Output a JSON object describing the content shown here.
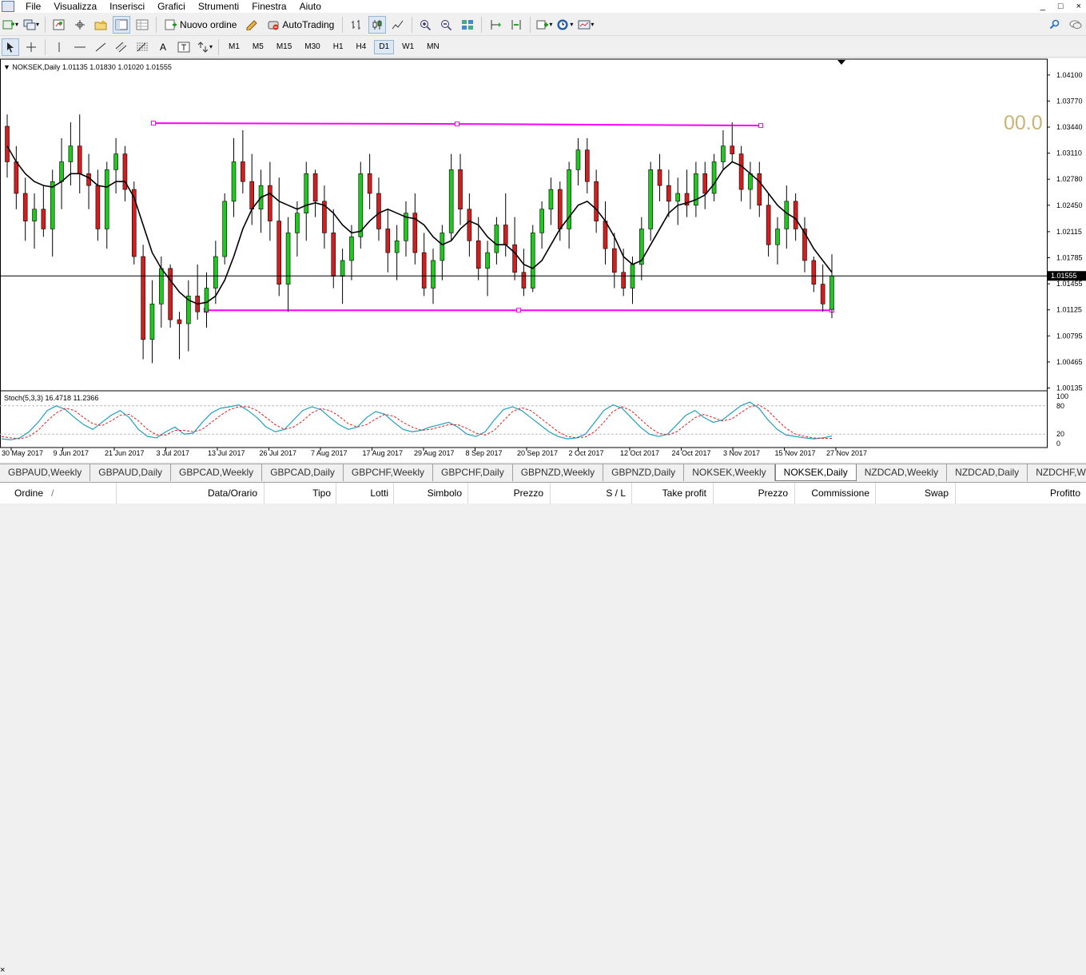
{
  "menu": {
    "items": [
      "File",
      "Visualizza",
      "Inserisci",
      "Grafici",
      "Strumenti",
      "Finestra",
      "Aiuto"
    ],
    "window_controls": [
      "_",
      "□",
      "×"
    ]
  },
  "toolbar": {
    "new_order_label": "Nuovo ordine",
    "autotrading_label": "AutoTrading",
    "timeframes": [
      "M1",
      "M5",
      "M15",
      "M30",
      "H1",
      "H4",
      "D1",
      "W1",
      "MN"
    ],
    "active_timeframe": "D1",
    "text_tool": "A"
  },
  "chart": {
    "symbol_header": "NOKSEK,Daily  1.01135 1.01830 1.01020 1.01555",
    "big_number": "00.0",
    "current_price": "1.01555",
    "indicator_label": "Stoch(5,3,3) 16.4718 11.2366",
    "colors": {
      "bull": "#1ec81e",
      "bear": "#d21e1e",
      "line": "#ff00ff",
      "stoch_main": "#20a0c0",
      "stoch_signal": "#e02020",
      "bignum": "#c8b474"
    }
  },
  "chart_data": {
    "type": "candlestick",
    "price_axis_labels": [
      "1.04100",
      "1.03770",
      "1.03440",
      "1.03110",
      "1.02780",
      "1.02450",
      "1.02115",
      "1.01785",
      "1.01455",
      "1.01125",
      "1.00795",
      "1.00465",
      "1.00135"
    ],
    "ylim": [
      1.0013,
      1.0425
    ],
    "date_labels": [
      "30 May 2017",
      "9 Jun 2017",
      "21 Jun 2017",
      "3 Jul 2017",
      "13 Jul 2017",
      "26 Jul 2017",
      "7 Aug 2017",
      "17 Aug 2017",
      "29 Aug 2017",
      "8 Sep 2017",
      "20 Sep 2017",
      "2 Oct 2017",
      "12 Oct 2017",
      "24 Oct 2017",
      "3 Nov 2017",
      "15 Nov 2017",
      "27 Nov 2017"
    ],
    "levels": [
      {
        "name": "resistance",
        "price": 1.035
      },
      {
        "name": "support",
        "price": 1.0112
      }
    ],
    "candles": [
      [
        1.0345,
        1.036,
        1.028,
        1.03
      ],
      [
        1.03,
        1.032,
        1.024,
        1.026
      ],
      [
        1.026,
        1.028,
        1.02,
        1.0225
      ],
      [
        1.0225,
        1.026,
        1.019,
        1.024
      ],
      [
        1.024,
        1.027,
        1.0205,
        1.0215
      ],
      [
        1.0215,
        1.029,
        1.018,
        1.0275
      ],
      [
        1.0275,
        1.033,
        1.024,
        1.03
      ],
      [
        1.03,
        1.035,
        1.027,
        1.032
      ],
      [
        1.032,
        1.036,
        1.026,
        1.0285
      ],
      [
        1.0285,
        1.031,
        1.024,
        1.027
      ],
      [
        1.027,
        1.029,
        1.02,
        1.0215
      ],
      [
        1.0215,
        1.03,
        1.019,
        1.029
      ],
      [
        1.029,
        1.033,
        1.026,
        1.031
      ],
      [
        1.031,
        1.032,
        1.025,
        1.0265
      ],
      [
        1.0265,
        1.0275,
        1.017,
        1.018
      ],
      [
        1.018,
        1.0195,
        1.005,
        1.0075
      ],
      [
        1.0075,
        1.015,
        1.0045,
        1.012
      ],
      [
        1.012,
        1.018,
        1.009,
        1.0165
      ],
      [
        1.0165,
        1.017,
        1.009,
        1.01
      ],
      [
        1.01,
        1.011,
        1.005,
        1.0095
      ],
      [
        1.0095,
        1.015,
        1.006,
        1.013
      ],
      [
        1.013,
        1.017,
        1.01,
        1.011
      ],
      [
        1.011,
        1.016,
        1.009,
        1.014
      ],
      [
        1.014,
        1.02,
        1.012,
        1.018
      ],
      [
        1.018,
        1.026,
        1.017,
        1.025
      ],
      [
        1.025,
        1.033,
        1.023,
        1.03
      ],
      [
        1.03,
        1.034,
        1.026,
        1.0275
      ],
      [
        1.0275,
        1.031,
        1.022,
        1.024
      ],
      [
        1.024,
        1.029,
        1.021,
        1.027
      ],
      [
        1.027,
        1.03,
        1.02,
        1.0225
      ],
      [
        1.0225,
        1.028,
        1.013,
        1.0145
      ],
      [
        1.0145,
        1.023,
        1.011,
        1.021
      ],
      [
        1.021,
        1.025,
        1.018,
        1.0235
      ],
      [
        1.0235,
        1.03,
        1.02,
        1.0285
      ],
      [
        1.0285,
        1.029,
        1.023,
        1.025
      ],
      [
        1.025,
        1.027,
        1.019,
        1.021
      ],
      [
        1.021,
        1.024,
        1.014,
        1.0155
      ],
      [
        1.0155,
        1.019,
        1.012,
        1.0175
      ],
      [
        1.0175,
        1.022,
        1.015,
        1.0205
      ],
      [
        1.0205,
        1.03,
        1.019,
        1.0285
      ],
      [
        1.0285,
        1.031,
        1.024,
        1.026
      ],
      [
        1.026,
        1.028,
        1.02,
        1.0215
      ],
      [
        1.0215,
        1.024,
        1.016,
        1.0185
      ],
      [
        1.0185,
        1.022,
        1.015,
        1.02
      ],
      [
        1.02,
        1.025,
        1.018,
        1.0235
      ],
      [
        1.0235,
        1.026,
        1.017,
        1.0185
      ],
      [
        1.0185,
        1.021,
        1.013,
        1.014
      ],
      [
        1.014,
        1.019,
        1.012,
        1.0175
      ],
      [
        1.0175,
        1.022,
        1.015,
        1.021
      ],
      [
        1.021,
        1.031,
        1.02,
        1.029
      ],
      [
        1.029,
        1.031,
        1.022,
        1.024
      ],
      [
        1.024,
        1.026,
        1.018,
        1.02
      ],
      [
        1.02,
        1.023,
        1.015,
        1.0165
      ],
      [
        1.0165,
        1.02,
        1.013,
        1.0185
      ],
      [
        1.0185,
        1.023,
        1.017,
        1.022
      ],
      [
        1.022,
        1.026,
        1.018,
        1.0195
      ],
      [
        1.0195,
        1.023,
        1.015,
        1.016
      ],
      [
        1.016,
        1.019,
        1.013,
        1.014
      ],
      [
        1.014,
        1.022,
        1.0135,
        1.021
      ],
      [
        1.021,
        1.025,
        1.019,
        1.024
      ],
      [
        1.024,
        1.028,
        1.022,
        1.0265
      ],
      [
        1.0265,
        1.0275,
        1.02,
        1.0215
      ],
      [
        1.0215,
        1.03,
        1.019,
        1.029
      ],
      [
        1.029,
        1.033,
        1.027,
        1.0315
      ],
      [
        1.0315,
        1.033,
        1.026,
        1.0275
      ],
      [
        1.0275,
        1.029,
        1.021,
        1.0225
      ],
      [
        1.0225,
        1.025,
        1.017,
        1.019
      ],
      [
        1.019,
        1.021,
        1.014,
        1.016
      ],
      [
        1.016,
        1.019,
        1.013,
        1.014
      ],
      [
        1.014,
        1.018,
        1.012,
        1.017
      ],
      [
        1.017,
        1.023,
        1.015,
        1.0215
      ],
      [
        1.0215,
        1.03,
        1.02,
        1.029
      ],
      [
        1.029,
        1.031,
        1.025,
        1.027
      ],
      [
        1.027,
        1.029,
        1.023,
        1.025
      ],
      [
        1.025,
        1.028,
        1.022,
        1.026
      ],
      [
        1.026,
        1.029,
        1.023,
        1.0245
      ],
      [
        1.0245,
        1.03,
        1.023,
        1.0285
      ],
      [
        1.0285,
        1.03,
        1.024,
        1.026
      ],
      [
        1.026,
        1.031,
        1.025,
        1.03
      ],
      [
        1.03,
        1.034,
        1.029,
        1.032
      ],
      [
        1.032,
        1.035,
        1.03,
        1.031
      ],
      [
        1.031,
        1.032,
        1.025,
        1.0265
      ],
      [
        1.0265,
        1.03,
        1.024,
        1.0285
      ],
      [
        1.0285,
        1.03,
        1.023,
        1.0245
      ],
      [
        1.0245,
        1.026,
        1.018,
        1.0195
      ],
      [
        1.0195,
        1.023,
        1.017,
        1.0215
      ],
      [
        1.0215,
        1.027,
        1.019,
        1.025
      ],
      [
        1.025,
        1.026,
        1.02,
        1.0215
      ],
      [
        1.0215,
        1.023,
        1.016,
        1.0175
      ],
      [
        1.0175,
        1.018,
        1.0135,
        1.0145
      ],
      [
        1.0145,
        1.017,
        1.011,
        1.012
      ],
      [
        1.0113,
        1.0183,
        1.0102,
        1.01555
      ]
    ],
    "ma": [
      1.032,
      1.03,
      1.0285,
      1.0275,
      1.027,
      1.0268,
      1.0275,
      1.0285,
      1.0285,
      1.028,
      1.027,
      1.0268,
      1.0275,
      1.0275,
      1.0255,
      1.022,
      1.0185,
      1.0165,
      1.015,
      1.0135,
      1.0125,
      1.012,
      1.0122,
      1.013,
      1.015,
      1.018,
      1.0215,
      1.024,
      1.0255,
      1.026,
      1.025,
      1.0245,
      1.024,
      1.0245,
      1.0248,
      1.0245,
      1.0235,
      1.022,
      1.021,
      1.0212,
      1.0225,
      1.0235,
      1.024,
      1.0235,
      1.023,
      1.0228,
      1.022,
      1.0205,
      1.0195,
      1.02,
      1.0215,
      1.0225,
      1.022,
      1.0205,
      1.0195,
      1.0195,
      1.0185,
      1.017,
      1.0165,
      1.0175,
      1.0195,
      1.0215,
      1.023,
      1.0245,
      1.025,
      1.024,
      1.0225,
      1.0205,
      1.018,
      1.017,
      1.0175,
      1.0195,
      1.0215,
      1.0235,
      1.0245,
      1.0248,
      1.0252,
      1.0258,
      1.0272,
      1.029,
      1.03,
      1.0295,
      1.0285,
      1.0275,
      1.026,
      1.0245,
      1.0235,
      1.0228,
      1.021,
      1.019,
      1.0175,
      1.016
    ],
    "stoch_main": [
      10,
      8,
      12,
      25,
      45,
      70,
      80,
      72,
      55,
      40,
      30,
      45,
      60,
      70,
      55,
      30,
      15,
      12,
      25,
      35,
      20,
      22,
      45,
      65,
      75,
      78,
      82,
      70,
      55,
      35,
      25,
      30,
      50,
      70,
      78,
      72,
      55,
      40,
      30,
      35,
      55,
      68,
      62,
      45,
      30,
      25,
      28,
      35,
      40,
      45,
      35,
      20,
      15,
      25,
      50,
      72,
      78,
      70,
      55,
      40,
      25,
      15,
      10,
      12,
      20,
      45,
      70,
      82,
      75,
      55,
      35,
      20,
      15,
      20,
      40,
      60,
      70,
      55,
      45,
      50,
      65,
      80,
      88,
      75,
      50,
      30,
      18,
      15,
      12,
      10,
      12,
      16
    ],
    "stoch_signal": [
      15,
      12,
      10,
      15,
      28,
      48,
      65,
      75,
      70,
      55,
      42,
      38,
      48,
      60,
      62,
      48,
      30,
      18,
      18,
      28,
      28,
      25,
      30,
      45,
      60,
      72,
      78,
      78,
      70,
      55,
      40,
      30,
      35,
      48,
      65,
      74,
      70,
      58,
      42,
      35,
      40,
      52,
      62,
      58,
      45,
      35,
      28,
      30,
      35,
      40,
      40,
      32,
      22,
      18,
      28,
      48,
      68,
      76,
      70,
      55,
      40,
      25,
      15,
      12,
      14,
      25,
      45,
      68,
      78,
      70,
      52,
      35,
      22,
      18,
      25,
      40,
      55,
      62,
      55,
      48,
      52,
      65,
      78,
      82,
      70,
      50,
      32,
      20,
      15,
      12,
      11,
      11
    ]
  },
  "tabs": [
    "GBPAUD,Weekly",
    "GBPAUD,Daily",
    "GBPCAD,Weekly",
    "GBPCAD,Daily",
    "GBPCHF,Weekly",
    "GBPCHF,Daily",
    "GBPNZD,Weekly",
    "GBPNZD,Daily",
    "NOKSEK,Weekly",
    "NOKSEK,Daily",
    "NZDCAD,Weekly",
    "NZDCAD,Daily",
    "NZDCHF,Week"
  ],
  "active_tab": "NOKSEK,Daily",
  "orders": {
    "close_glyph": "×",
    "headers": [
      "Ordine",
      "/",
      "Data/Orario",
      "Tipo",
      "Lotti",
      "Simbolo",
      "Prezzo",
      "S / L",
      "Take profit",
      "Prezzo",
      "Commissione",
      "Swap",
      "Profitto"
    ]
  }
}
